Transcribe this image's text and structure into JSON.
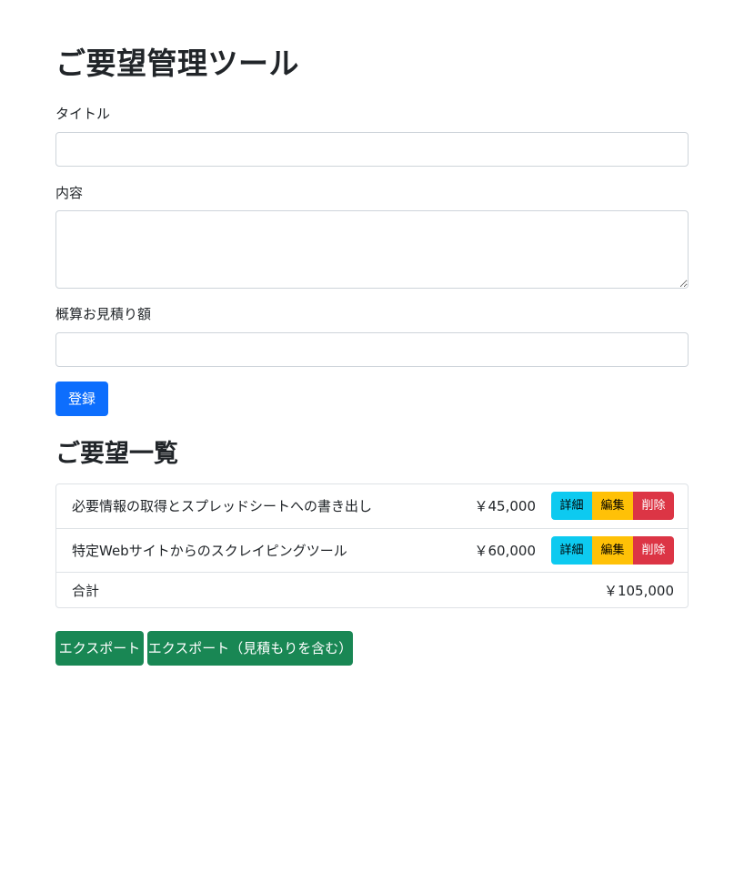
{
  "page": {
    "title": "ご要望管理ツール"
  },
  "form": {
    "title_label": "タイトル",
    "title_value": "",
    "content_label": "内容",
    "content_value": "",
    "estimate_label": "概算お見積り額",
    "estimate_value": "",
    "submit_label": "登録"
  },
  "list": {
    "heading": "ご要望一覧",
    "items": [
      {
        "title": "必要情報の取得とスプレッドシートへの書き出し",
        "price": "￥45,000",
        "detail_label": "詳細",
        "edit_label": "編集",
        "delete_label": "削除"
      },
      {
        "title": "特定Webサイトからのスクレイピングツール",
        "price": "￥60,000",
        "detail_label": "詳細",
        "edit_label": "編集",
        "delete_label": "削除"
      }
    ],
    "total_label": "合計",
    "total_price": "￥105,000"
  },
  "export": {
    "export_label": "エクスポート",
    "export_with_estimate_label": "エクスポート（見積もりを含む）"
  },
  "colors": {
    "primary": "#0d6efd",
    "success": "#198754",
    "info": "#0dcaf0",
    "warning": "#ffc107",
    "danger": "#dc3545"
  }
}
